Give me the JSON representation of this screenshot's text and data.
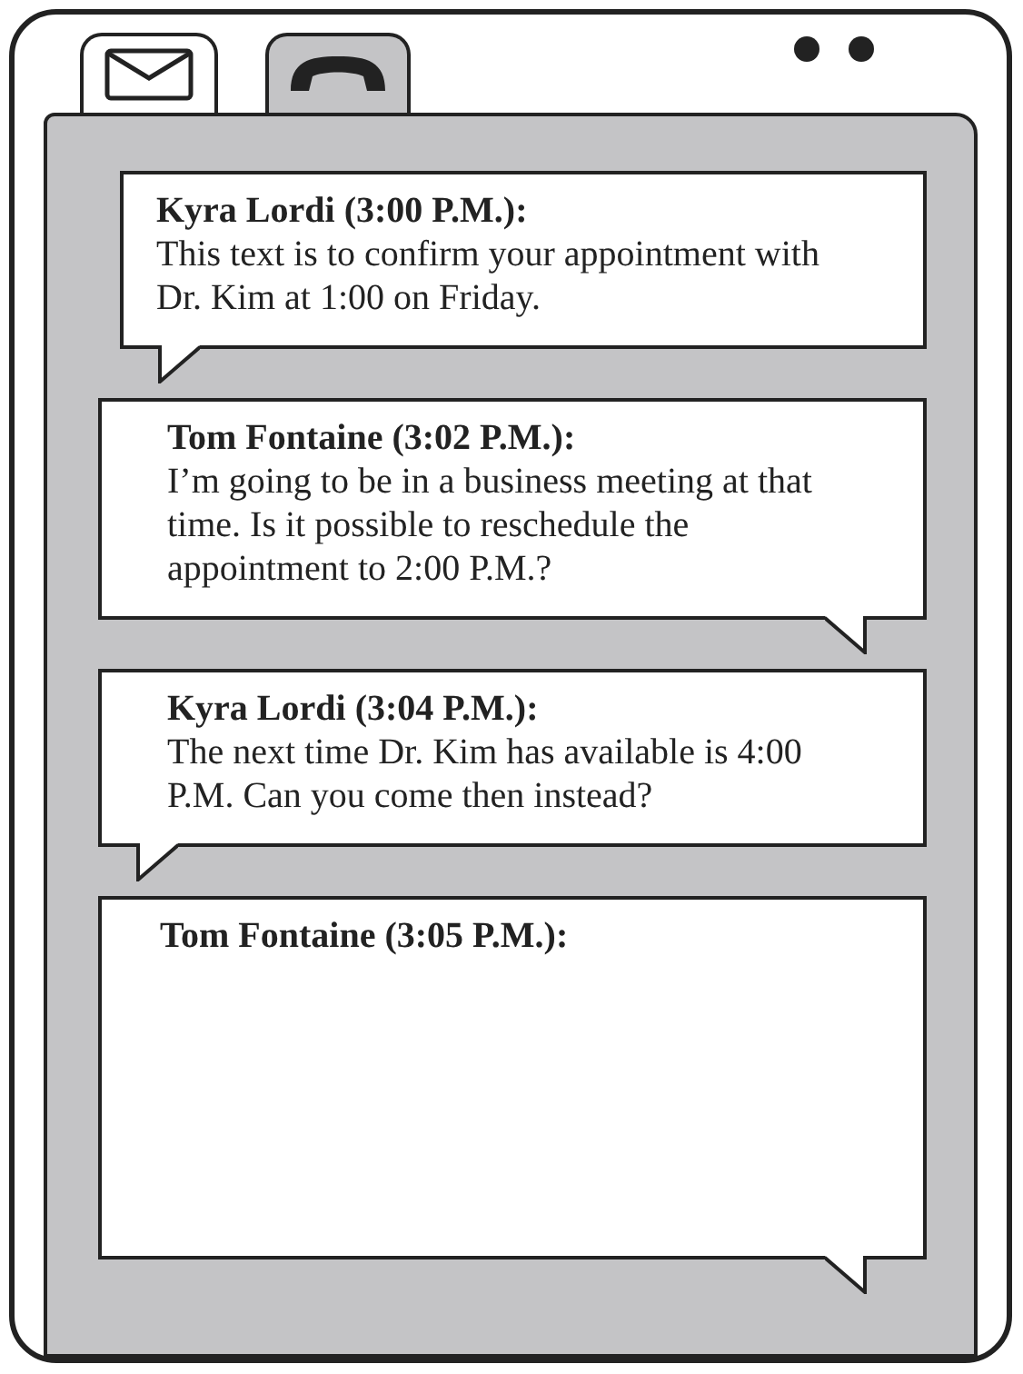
{
  "tabs": [
    {
      "kind": "mail",
      "selected": true
    },
    {
      "kind": "phone",
      "selected": false
    }
  ],
  "messages": [
    {
      "header": "Kyra Lordi (3:00 P.M.):",
      "body": "This text is to confirm your appointment with Dr. Kim at 1:00 on Friday.",
      "kind": "received"
    },
    {
      "header": "Tom Fontaine (3:02 P.M.):",
      "body": "I’m going to be in a business meeting at that time. Is it possible to reschedule the appointment to 2:00 P.M.?",
      "kind": "sent"
    },
    {
      "header": "Kyra Lordi (3:04 P.M.):",
      "body": "The next time Dr. Kim has available is 4:00 P.M. Can you come then instead?",
      "kind": "received"
    },
    {
      "header": "Tom Fontaine (3:05 P.M.):",
      "kind": "sent"
    }
  ]
}
